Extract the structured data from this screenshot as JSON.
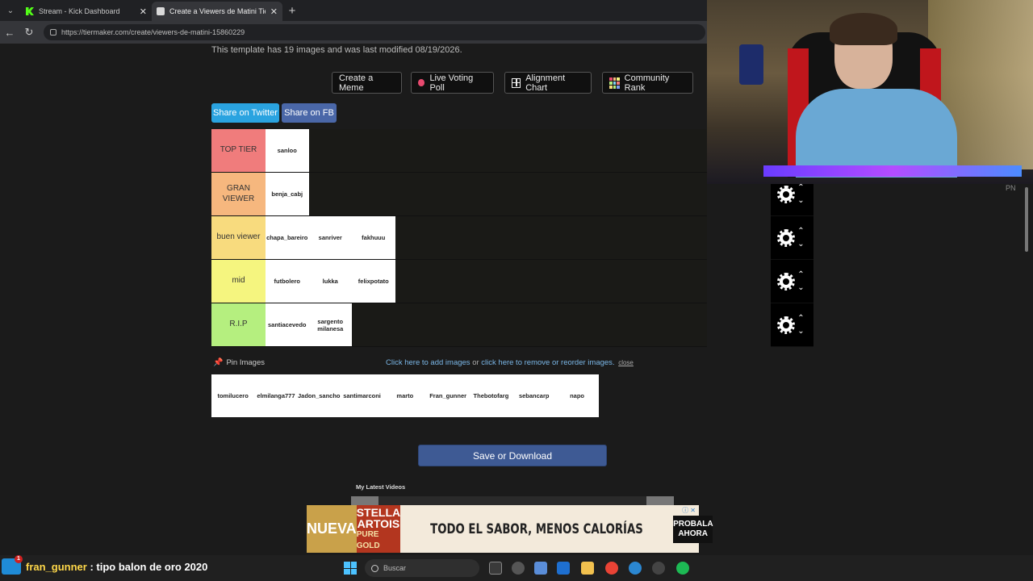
{
  "tabs": [
    {
      "label": "Stream - Kick Dashboard",
      "active": false
    },
    {
      "label": "Create a Viewers de Matini Tier List",
      "active": true
    }
  ],
  "address": {
    "url": "https://tiermaker.com/create/viewers-de-matini-15860229"
  },
  "page": {
    "info": "This template has 19 images and was last modified 08/19/2026.",
    "buttons": {
      "create_meme": "Create a Meme",
      "live_voting": "Live Voting Poll",
      "alignment": "Alignment Chart",
      "community": "Community Rank"
    },
    "share": {
      "twitter": "Share on Twitter",
      "fb": "Share on FB"
    },
    "tiers": [
      {
        "label": "TOP TIER",
        "color": "#f07c7c",
        "items": [
          "sanloo"
        ]
      },
      {
        "label": "GRAN VIEWER",
        "color": "#f6b77e",
        "items": [
          "benja_cabj"
        ]
      },
      {
        "label": "buen viewer",
        "color": "#f8db7e",
        "items": [
          "chapa_bareiro",
          "sanriver",
          "fakhuuu"
        ]
      },
      {
        "label": "mid",
        "color": "#f5f57f",
        "items": [
          "futbolero",
          "lukka",
          "felixpotato"
        ]
      },
      {
        "label": "R.I.P",
        "color": "#b5ef7f",
        "items": [
          "santiacevedo",
          "sargento milanesa"
        ]
      }
    ],
    "pin_label": "Pin Images",
    "helper": {
      "add": "Click here to add images",
      "or": " or ",
      "remove": "click here to remove or reorder images.",
      "close": "close"
    },
    "pool": [
      "tomilucero",
      "elmilanga777",
      "Jadon_sancho",
      "santimarconi",
      "marto",
      "Fran_gunner",
      "Thebotofarg",
      "sebancarp",
      "napo"
    ],
    "save": "Save or Download",
    "latest_videos": "My Latest Videos",
    "pn": "PN"
  },
  "ad": {
    "nueva": "NUEVA",
    "brand_line1": "STELLA",
    "brand_line2": "ARTOIS",
    "brand_line3": "PURE GOLD",
    "headline": "TODO EL SABOR, MENOS CALORÍAS",
    "cta": "PROBALA AHORA"
  },
  "chat": {
    "user": "fran_gunner",
    "message": " : tipo balon de oro 2020"
  },
  "taskbar": {
    "search_placeholder": "Buscar"
  }
}
